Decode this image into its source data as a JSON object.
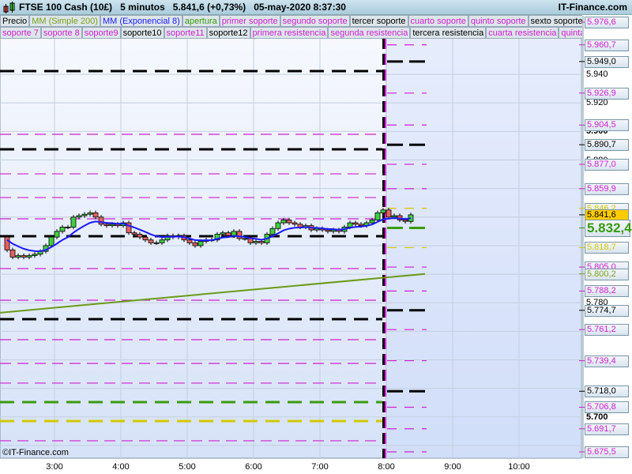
{
  "header": {
    "instrument": "FTSE 100 Cash (10£)",
    "timeframe": "5 minutos",
    "last": "5.841,6 (+0,73%)",
    "datetime": "05-may-2020 8:37:30",
    "site": "IT-Finance.com"
  },
  "legend_row1": [
    {
      "label": "Precio",
      "color": "#000000"
    },
    {
      "label": "MM (Simple 200)",
      "color": "#7aa01c"
    },
    {
      "label": "MM (Exponencial 8)",
      "color": "#1a1aff"
    },
    {
      "label": "apertura",
      "color": "#3a9a10"
    },
    {
      "label": "primer soporte",
      "color": "#d020d0"
    },
    {
      "label": "segundo soporte",
      "color": "#d020d0"
    },
    {
      "label": "tercer soporte",
      "color": "#000000"
    },
    {
      "label": "cuarto soporte",
      "color": "#d020d0"
    },
    {
      "label": "quinto soporte",
      "color": "#d020d0"
    },
    {
      "label": "sexto soporte",
      "color": "#000000"
    }
  ],
  "legend_row2": [
    {
      "label": "soporte 7",
      "color": "#d020d0"
    },
    {
      "label": "soporte 8",
      "color": "#d020d0"
    },
    {
      "label": "soporte9",
      "color": "#d020d0"
    },
    {
      "label": "soporte10",
      "color": "#000000"
    },
    {
      "label": "soporte11",
      "color": "#d020d0"
    },
    {
      "label": "soporte12",
      "color": "#000000"
    },
    {
      "label": "primera resistencia",
      "color": "#d020d0"
    },
    {
      "label": "segunda resistencia",
      "color": "#d020d0"
    },
    {
      "label": "tercera resistencia",
      "color": "#000000"
    },
    {
      "label": "cuarta resistencia",
      "color": "#d020d0"
    },
    {
      "label": "quinta r",
      "color": "#d020d0"
    }
  ],
  "copyright": "©IT-Finance.com",
  "chart_data": {
    "type": "candlestick",
    "ylim": [
      5675,
      5980
    ],
    "x_ticks": [
      "3:00",
      "4:00",
      "5:00",
      "6:00",
      "7:00",
      "8:00",
      "9:00",
      "10:00"
    ],
    "y_ticks": [
      "5.940",
      "5.920",
      "5.900",
      "5.880",
      "5.780",
      "5.700"
    ],
    "price_labels": [
      {
        "text": "5.976,6",
        "value": 5976.6,
        "color": "#d020d0"
      },
      {
        "text": "5.960,7",
        "value": 5960.7,
        "color": "#d020d0"
      },
      {
        "text": "5.949,0",
        "value": 5949.0,
        "color": "#000000"
      },
      {
        "text": "5.926,9",
        "value": 5926.9,
        "color": "#d020d0"
      },
      {
        "text": "5.904,5",
        "value": 5904.5,
        "color": "#d020d0"
      },
      {
        "text": "5.890,7",
        "value": 5890.7,
        "color": "#000000"
      },
      {
        "text": "5.877,0",
        "value": 5877.0,
        "color": "#d020d0"
      },
      {
        "text": "5.859,9",
        "value": 5859.9,
        "color": "#d020d0"
      },
      {
        "text": "5.846,2",
        "value": 5846.2,
        "color": "#d4c800"
      },
      {
        "text": "5.841,6",
        "value": 5841.6,
        "color": "#000000",
        "bg": "#ffcc00"
      },
      {
        "text": "5.832,4",
        "value": 5832.4,
        "color": "#3a9a10",
        "big": true
      },
      {
        "text": "5.818,7",
        "value": 5818.7,
        "color": "#d4c800"
      },
      {
        "text": "5.805,0",
        "value": 5805.0,
        "color": "#d020d0"
      },
      {
        "text": "5.800,2",
        "value": 5800.2,
        "color": "#7aa01c"
      },
      {
        "text": "5.788,2",
        "value": 5788.2,
        "color": "#d020d0"
      },
      {
        "text": "5.774,7",
        "value": 5774.7,
        "color": "#000000"
      },
      {
        "text": "5.761,2",
        "value": 5761.2,
        "color": "#d020d0"
      },
      {
        "text": "5.739,4",
        "value": 5739.4,
        "color": "#d020d0"
      },
      {
        "text": "5.718,0",
        "value": 5718.0,
        "color": "#000000"
      },
      {
        "text": "5.706,8",
        "value": 5706.8,
        "color": "#d020d0"
      },
      {
        "text": "5.691,7",
        "value": 5691.7,
        "color": "#d020d0"
      },
      {
        "text": "5.675,5",
        "value": 5675.5,
        "color": "#d020d0"
      }
    ],
    "previous_levels": [
      {
        "value": 5942.3,
        "color": "#000000"
      },
      {
        "value": 5887.5,
        "color": "#000000"
      },
      {
        "value": 5826.6,
        "color": "#000000"
      },
      {
        "value": 5768.5,
        "color": "#000000"
      },
      {
        "value": 5710.4,
        "color": "#3a9a10"
      },
      {
        "value": 5697.1,
        "color": "#d4c800"
      },
      {
        "value": 5898.0,
        "color": "#d020d0"
      },
      {
        "value": 5870.3,
        "color": "#d020d0"
      },
      {
        "value": 5853.7,
        "color": "#d020d0"
      },
      {
        "value": 5838.8,
        "color": "#d020d0"
      },
      {
        "value": 5803.9,
        "color": "#d020d0"
      },
      {
        "value": 5781.8,
        "color": "#d020d0"
      },
      {
        "value": 5754.1,
        "color": "#d020d0"
      },
      {
        "value": 5737.5,
        "color": "#d020d0"
      },
      {
        "value": 5723.7,
        "color": "#d020d0"
      },
      {
        "value": 5683.3,
        "color": "#d020d0"
      }
    ],
    "first_time": "2:15",
    "interval_minutes": 5,
    "first_open": 5826,
    "closes": [
      5817,
      5812,
      5813,
      5812,
      5813,
      5814,
      5816,
      5820,
      5826,
      5830,
      5833,
      5833,
      5840,
      5841,
      5842,
      5843,
      5840,
      5835,
      5834,
      5835,
      5834,
      5836,
      5829,
      5828,
      5826,
      5824,
      5822,
      5822,
      5824,
      5827,
      5826,
      5827,
      5824,
      5822,
      5820,
      5823,
      5824,
      5824,
      5828,
      5829,
      5827,
      5830,
      5825,
      5825,
      5822,
      5823,
      5822,
      5828,
      5832,
      5836,
      5838,
      5836,
      5835,
      5833,
      5834,
      5831,
      5832,
      5831,
      5830,
      5831,
      5830,
      5833,
      5836,
      5835,
      5834,
      5836,
      5838,
      5843,
      5845,
      5840,
      5841,
      5838,
      5837,
      5841.6
    ],
    "sma200": {
      "start": 5773,
      "end": 5800.2
    }
  }
}
